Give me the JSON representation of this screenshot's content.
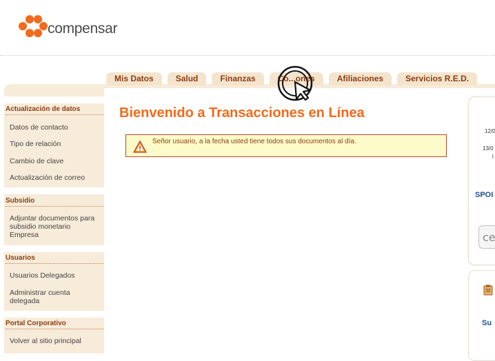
{
  "brand": {
    "name": "compensar",
    "color": "#f26a1b"
  },
  "tabs": [
    {
      "label": "Mis Datos"
    },
    {
      "label": "Salud"
    },
    {
      "label": "Finanzas"
    },
    {
      "label": "Co...ones"
    },
    {
      "label": "Afiliaciones"
    },
    {
      "label": "Servicios R.E.D."
    }
  ],
  "sidebar": {
    "sections": [
      {
        "title": "Actualización de datos",
        "items": [
          "Datos de contacto",
          "Tipo de relación",
          "Cambio de clave",
          "Actualización de correo"
        ]
      },
      {
        "title": "Subsidio",
        "items": [
          "Adjuntar documentos para subsidio monetario Empresa"
        ]
      },
      {
        "title": "Usuarios",
        "items": [
          "Usuarios Delegados",
          "Administrar cuenta delegada"
        ]
      },
      {
        "title": "Portal Corporativo",
        "items": [
          "Volver al sitio principal"
        ]
      }
    ]
  },
  "main": {
    "title": "Bienvenido a Transacciones en Línea",
    "notice": "Señor usuario, a la fecha usted tiene todos sus documentos al día."
  },
  "right_panel": {
    "date1": "12/0",
    "date2": "13/0",
    "date2_sub": "l",
    "spot": "SPOI",
    "box_text": "cel",
    "su": "Su"
  }
}
